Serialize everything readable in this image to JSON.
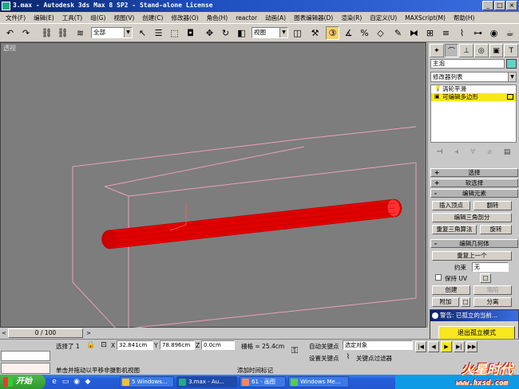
{
  "window": {
    "title": "3.max - Autodesk 3ds Max 8 SP2 - Stand-alone License",
    "controls": [
      "_",
      "□",
      "×"
    ]
  },
  "menu": [
    "文件(F)",
    "编辑(E)",
    "工具(T)",
    "组(G)",
    "视图(V)",
    "创建(C)",
    "修改器(O)",
    "角色(H)",
    "reactor",
    "动画(A)",
    "图表编辑器(D)",
    "渲染(R)",
    "自定义(U)",
    "MAXScript(M)",
    "帮助(H)"
  ],
  "toolbar": {
    "selection_filter": "全部",
    "reference_coord": "视图"
  },
  "viewport": {
    "label": "透视"
  },
  "command_panel": {
    "object_name": "主泡",
    "object_color": "#5fd3c8",
    "modifier_list": "修改器列表",
    "stack": [
      {
        "icon": "light-bulb-icon",
        "label": "涡轮平滑",
        "selected": false
      },
      {
        "icon": "checkbox-icon",
        "label": "可编辑多边形",
        "selected": true
      }
    ],
    "rollouts": {
      "selection": "选择",
      "soft_selection": "软选择",
      "edit_elements": "编辑元素",
      "edit_geometry": "编辑几何体"
    },
    "buttons": {
      "insert_vertex": "插入顶点",
      "flip": "翻转",
      "edit_triangulation": "编辑三角剖分",
      "retriangulate": "重复三角算法",
      "turn": "旋转",
      "repeat_last": "重复上一个",
      "constraints_label": "约束",
      "constraints_value": "无",
      "preserve_uv": "保持 UV",
      "create": "创建",
      "collapse": "塌陷",
      "attach": "附加",
      "detach": "分离"
    }
  },
  "popup": {
    "title": "警告: 已孤立的当前...",
    "button": "退出孤立模式"
  },
  "time_slider": {
    "label": "0 / 100"
  },
  "status": {
    "selected": "选择了 1",
    "x_label": "X",
    "x_value": "32.841cm",
    "y_label": "Y",
    "y_value": "78.896cm",
    "z_label": "Z",
    "z_value": "0.0cm",
    "grid": "栅格 = 25.4cm",
    "auto_key": "自动关键点",
    "set_key": "设置关键点",
    "key_filter_value": "选定对象",
    "key_filters": "关键点过滤器",
    "prompt": "单击并拖动以平移非摄影机视图",
    "add_time_tag": "添加时间标记"
  },
  "taskbar": {
    "start": "开始",
    "tasks": [
      {
        "label": "5 Windows...",
        "active": false
      },
      {
        "label": "3.max - Au...",
        "active": true
      },
      {
        "label": "61 - 画图",
        "active": false
      },
      {
        "label": "Windows Me...",
        "active": false
      }
    ]
  },
  "watermark": {
    "line1": "火星时代",
    "line2": "www.hxsd.com"
  }
}
